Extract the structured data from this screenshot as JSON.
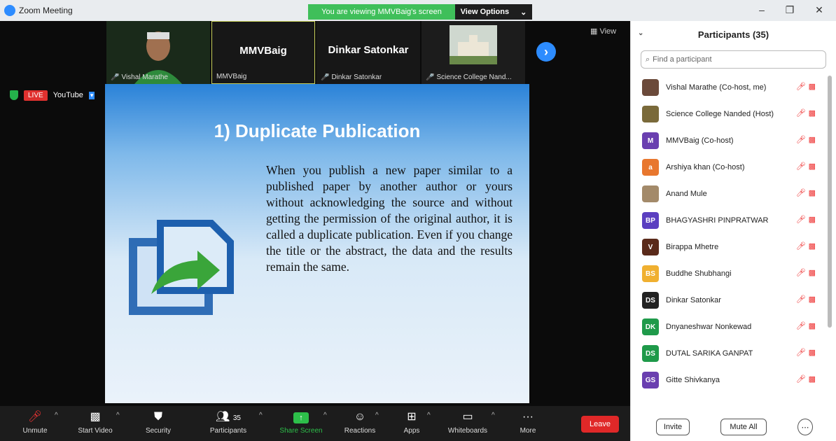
{
  "window": {
    "title": "Zoom Meeting",
    "viewing_banner": "You are viewing MMVBaig's screen",
    "view_options": "View Options",
    "minimize": "–",
    "maximize": "❐",
    "close": "✕"
  },
  "thumbnails": [
    {
      "big": "",
      "label": "Vishal Marathe",
      "muted": true,
      "photo": true
    },
    {
      "big": "MMVBaig",
      "label": "MMVBaig",
      "muted": false,
      "photo": false
    },
    {
      "big": "Dinkar Satonkar",
      "label": "Dinkar Satonkar",
      "muted": true,
      "photo": false
    },
    {
      "big": "",
      "label": "Science College Nand...",
      "muted": true,
      "photo": true
    }
  ],
  "view_label": "View",
  "live": {
    "badge": "LIVE",
    "platform": "YouTube"
  },
  "slide": {
    "title": "1) Duplicate Publication",
    "body": "When you publish a new paper similar to a published paper by another author or yours without acknowledging the source and without getting the permission of the original author, it is called a duplicate publication. Even if you change the title or the abstract, the data and the results remain the same."
  },
  "controls": {
    "unmute": "Unmute",
    "start_video": "Start Video",
    "security": "Security",
    "participants": "Participants",
    "participants_count": "35",
    "share_screen": "Share Screen",
    "reactions": "Reactions",
    "apps": "Apps",
    "whiteboards": "Whiteboards",
    "more": "More",
    "leave": "Leave"
  },
  "panel": {
    "title": "Participants (35)",
    "search_placeholder": "Find a participant",
    "participants": [
      {
        "initials": "",
        "name": "Vishal Marathe (Co-host, me)",
        "color": "#6b4a3a"
      },
      {
        "initials": "",
        "name": "Science College Nanded (Host)",
        "color": "#7a6a3a"
      },
      {
        "initials": "M",
        "name": "MMVBaig (Co-host)",
        "color": "#6a3fb0"
      },
      {
        "initials": "a",
        "name": "Arshiya khan (Co-host)",
        "color": "#e8772e"
      },
      {
        "initials": "",
        "name": "Anand Mule",
        "color": "#a38a6a"
      },
      {
        "initials": "BP",
        "name": "BHAGYASHRI PINPRATWAR",
        "color": "#5b3fc0"
      },
      {
        "initials": "V",
        "name": "Birappa Mhetre",
        "color": "#5a2a1a"
      },
      {
        "initials": "BS",
        "name": "Buddhe Shubhangi",
        "color": "#f0b030"
      },
      {
        "initials": "DS",
        "name": "Dinkar Satonkar",
        "color": "#222222"
      },
      {
        "initials": "DK",
        "name": "Dnyaneshwar Nonkewad",
        "color": "#1f9a4a"
      },
      {
        "initials": "DS",
        "name": "DUTAL SARIKA GANPAT",
        "color": "#1f9a4a"
      },
      {
        "initials": "GS",
        "name": "Gitte Shivkanya",
        "color": "#6a3fb0"
      }
    ],
    "invite": "Invite",
    "mute_all": "Mute All",
    "more": "⋯"
  }
}
